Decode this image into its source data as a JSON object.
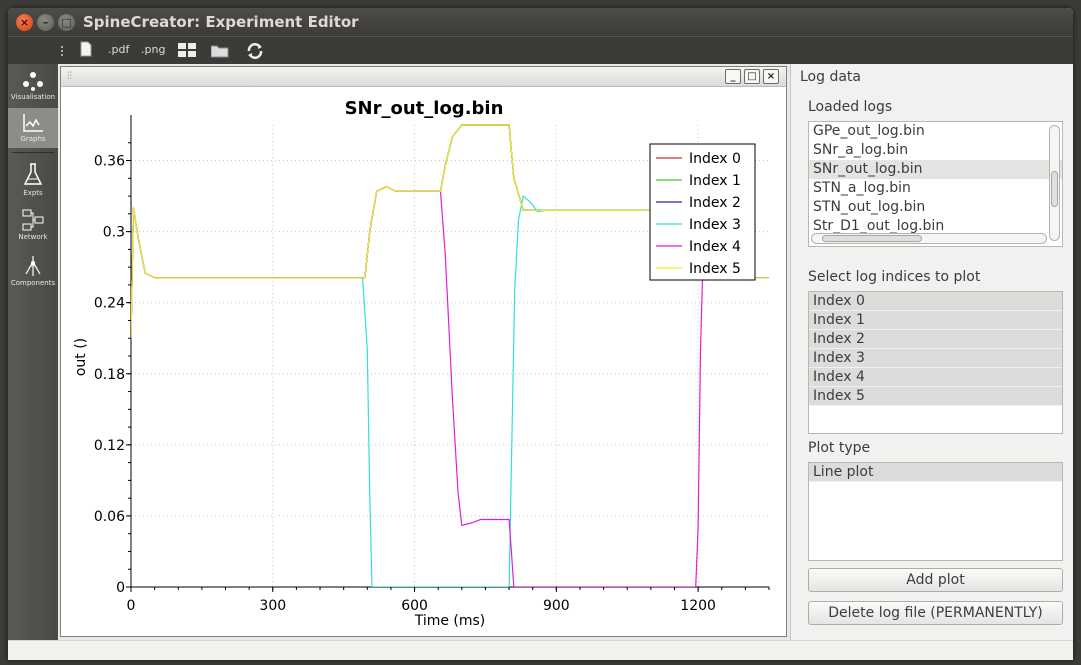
{
  "window": {
    "title": "SpineCreator: Experiment Editor"
  },
  "toolbar": {
    "pdf_label": ".pdf",
    "png_label": ".png"
  },
  "leftbar": {
    "items": [
      {
        "label": "Visualisation"
      },
      {
        "label": "Graphs"
      },
      {
        "label": "Expts"
      },
      {
        "label": "Network"
      },
      {
        "label": "Components"
      }
    ]
  },
  "panel": {
    "title": "Log data",
    "loaded_logs_label": "Loaded logs",
    "loaded_logs": [
      "GPe_out_log.bin",
      "SNr_a_log.bin",
      "SNr_out_log.bin",
      "STN_a_log.bin",
      "STN_out_log.bin",
      "Str_D1_out_log.bin"
    ],
    "indices_label": "Select log indices to plot",
    "indices": [
      "Index 0",
      "Index 1",
      "Index 2",
      "Index 3",
      "Index 4",
      "Index 5"
    ],
    "plot_type_label": "Plot type",
    "plot_types": [
      "Line plot"
    ],
    "add_plot_label": "Add plot",
    "delete_label": "Delete log file (PERMANENTLY)"
  },
  "chart_data": {
    "type": "line",
    "title": "SNr_out_log.bin",
    "xlabel": "Time (ms)",
    "ylabel": "out ()",
    "xlim": [
      0,
      1350
    ],
    "ylim": [
      0,
      0.39
    ],
    "xticks": [
      0,
      300,
      600,
      900,
      1200,
      1500,
      1800
    ],
    "yticks": [
      0,
      0.06,
      0.12,
      0.18,
      0.24,
      0.3,
      0.36
    ],
    "grid": true,
    "legend_position": "top-right",
    "series": [
      {
        "name": "Index 0",
        "color": "#c0392b",
        "x": [
          0,
          5,
          15,
          30,
          50,
          495,
          505,
          520,
          540,
          560,
          655,
          665,
          680,
          700,
          800,
          810,
          830,
          1200,
          1210,
          1230,
          1240,
          1260,
          2000
        ],
        "y": [
          0.21,
          0.32,
          0.295,
          0.265,
          0.261,
          0.261,
          0.3,
          0.334,
          0.338,
          0.334,
          0.334,
          0.356,
          0.38,
          0.39,
          0.39,
          0.345,
          0.318,
          0.318,
          0.275,
          0.262,
          0.26,
          0.261,
          0.261
        ]
      },
      {
        "name": "Index 1",
        "color": "#44cc33",
        "x": [
          0,
          5,
          15,
          30,
          50,
          495,
          505,
          520,
          540,
          560,
          655,
          665,
          680,
          700,
          800,
          810,
          830,
          1200,
          1210,
          1230,
          1240,
          1260,
          2000
        ],
        "y": [
          0.21,
          0.32,
          0.295,
          0.265,
          0.261,
          0.261,
          0.3,
          0.334,
          0.338,
          0.334,
          0.334,
          0.356,
          0.38,
          0.39,
          0.39,
          0.345,
          0.318,
          0.318,
          0.275,
          0.262,
          0.26,
          0.261,
          0.261
        ]
      },
      {
        "name": "Index 2",
        "color": "#2828a0",
        "x": [
          0,
          5,
          15,
          30,
          50,
          495,
          505,
          520,
          540,
          560,
          655,
          665,
          680,
          700,
          800,
          810,
          830,
          1200,
          1210,
          1230,
          1240,
          1260,
          2000
        ],
        "y": [
          0.21,
          0.32,
          0.295,
          0.265,
          0.261,
          0.261,
          0.3,
          0.334,
          0.338,
          0.334,
          0.334,
          0.356,
          0.38,
          0.39,
          0.39,
          0.345,
          0.318,
          0.318,
          0.275,
          0.262,
          0.26,
          0.261,
          0.261
        ]
      },
      {
        "name": "Index 3",
        "color": "#33dddd",
        "x": [
          0,
          5,
          15,
          30,
          50,
          490,
          500,
          505,
          510,
          800,
          812,
          820,
          830,
          845,
          860,
          880,
          1200,
          1210,
          1230,
          1240,
          1260,
          2000
        ],
        "y": [
          0.21,
          0.32,
          0.295,
          0.265,
          0.261,
          0.261,
          0.2,
          0.08,
          0,
          0,
          0.25,
          0.31,
          0.33,
          0.325,
          0.317,
          0.318,
          0.318,
          0.275,
          0.262,
          0.26,
          0.261,
          0.261
        ]
      },
      {
        "name": "Index 4",
        "color": "#e020d0",
        "x": [
          0,
          5,
          15,
          30,
          50,
          495,
          505,
          520,
          540,
          560,
          655,
          665,
          680,
          692,
          700,
          720,
          740,
          800,
          805,
          810,
          1195,
          1200,
          1205,
          1210,
          1215,
          1225,
          1235,
          1245,
          1260,
          2000
        ],
        "y": [
          0.21,
          0.32,
          0.295,
          0.265,
          0.261,
          0.261,
          0.3,
          0.334,
          0.338,
          0.334,
          0.334,
          0.28,
          0.16,
          0.08,
          0.052,
          0.054,
          0.057,
          0.057,
          0.03,
          0,
          0,
          0.05,
          0.2,
          0.27,
          0.26,
          0.272,
          0.27,
          0.262,
          0.261,
          0.261
        ]
      },
      {
        "name": "Index 5",
        "color": "#f0f020",
        "x": [
          0,
          5,
          15,
          30,
          50,
          495,
          505,
          520,
          540,
          560,
          655,
          665,
          680,
          700,
          800,
          810,
          830,
          1200,
          1210,
          1230,
          1240,
          1260,
          2000
        ],
        "y": [
          0.21,
          0.32,
          0.295,
          0.265,
          0.261,
          0.261,
          0.3,
          0.334,
          0.338,
          0.334,
          0.334,
          0.356,
          0.38,
          0.39,
          0.39,
          0.345,
          0.318,
          0.318,
          0.275,
          0.262,
          0.26,
          0.261,
          0.261
        ]
      }
    ]
  }
}
